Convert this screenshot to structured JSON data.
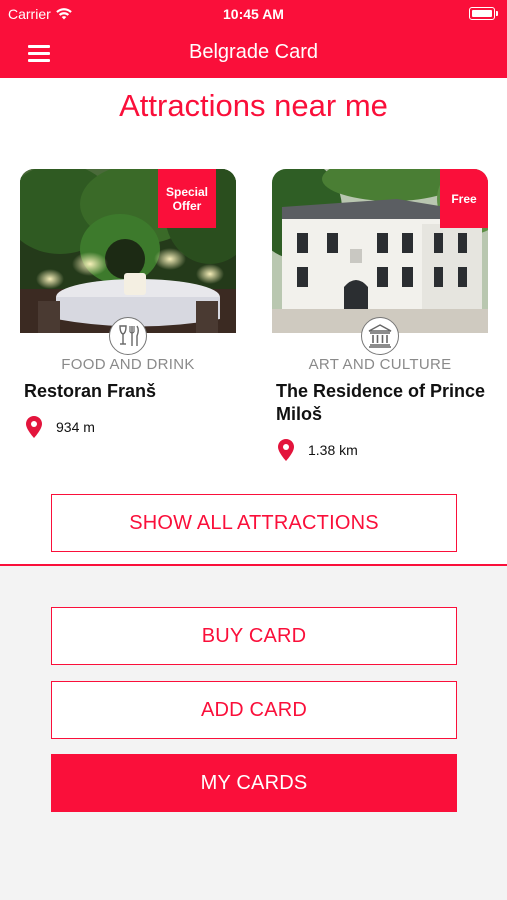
{
  "status_bar": {
    "carrier": "Carrier",
    "time": "10:45 AM"
  },
  "nav": {
    "title": "Belgrade Card",
    "menu_icon": "hamburger-menu-icon"
  },
  "heading": "Attractions near me",
  "attractions": [
    {
      "badge": "Special Offer",
      "category": "FOOD AND DRINK",
      "category_icon": "wine-cutlery-icon",
      "name": "Restoran Franš",
      "distance": "934 m"
    },
    {
      "badge": "Free",
      "category": "ART AND CULTURE",
      "category_icon": "museum-icon",
      "name": "The Residence of Prince Miloš",
      "distance": "1.38 km"
    }
  ],
  "buttons": {
    "show_all": "SHOW ALL ATTRACTIONS",
    "buy_card": "BUY CARD",
    "add_card": "ADD CARD",
    "my_cards": "MY CARDS"
  },
  "colors": {
    "accent": "#fa0f3a",
    "background_bottom": "#f3f3f3"
  }
}
